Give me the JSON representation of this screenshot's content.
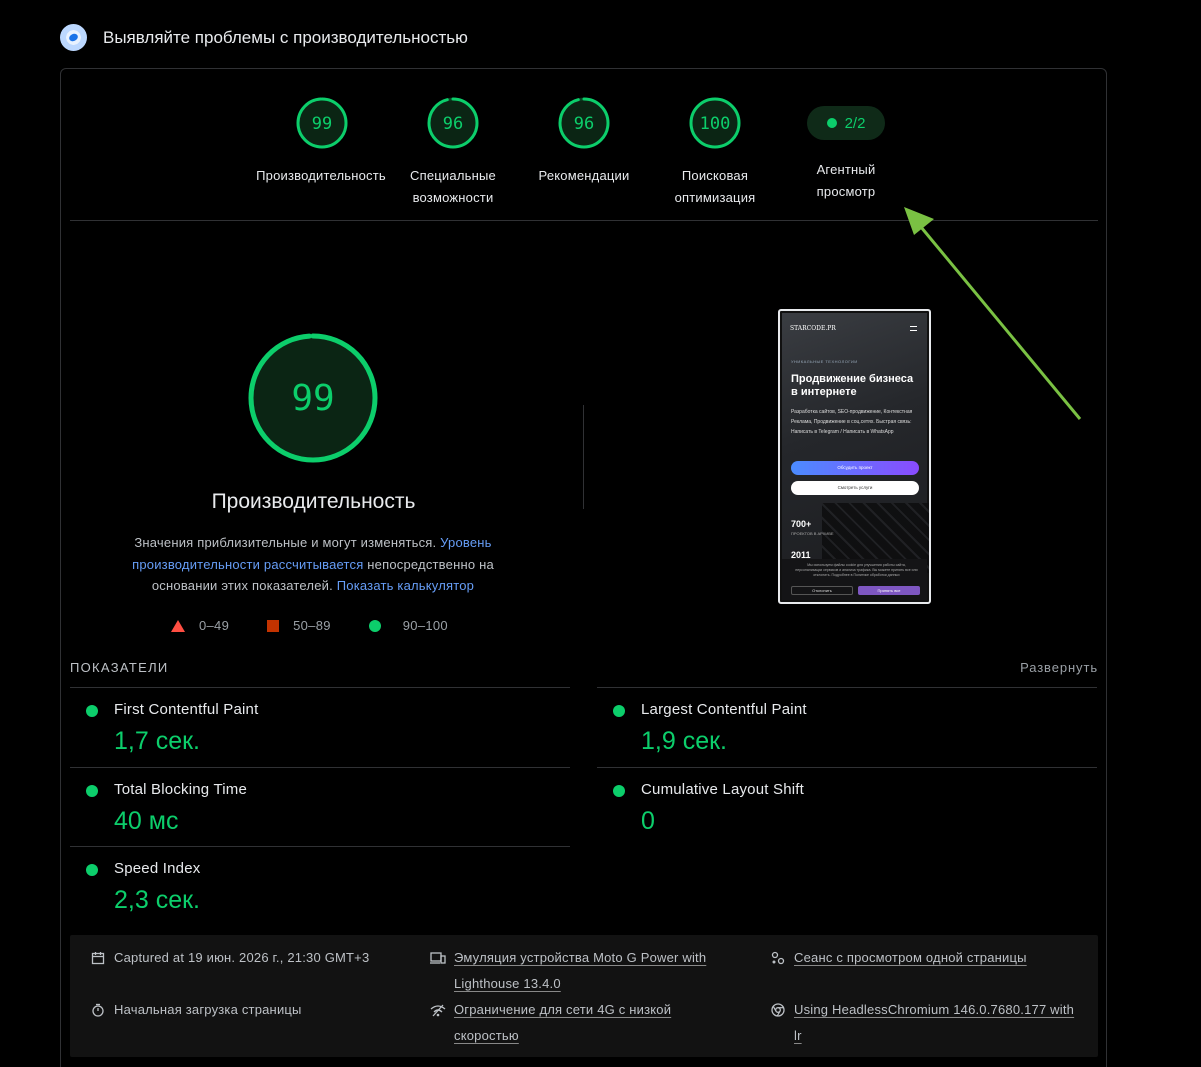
{
  "header": {
    "title": "Выявляйте проблемы с производительностью"
  },
  "categories": [
    {
      "score": "99",
      "label_line1": "Производительность",
      "label_line2": "",
      "value": 99
    },
    {
      "score": "96",
      "label_line1": "Специальные",
      "label_line2": "возможности",
      "value": 96
    },
    {
      "score": "96",
      "label_line1": "Рекомендации",
      "label_line2": "",
      "value": 96
    },
    {
      "score": "100",
      "label_line1": "Поисковая",
      "label_line2": "оптимизация",
      "value": 100
    },
    {
      "score": "2/2",
      "label_line1": "Агентный",
      "label_line2": "просмотр"
    }
  ],
  "performance": {
    "score": "99",
    "value": 99,
    "title": "Производительность",
    "note_text": "Значения приблизительные и могут изменяться. ",
    "note_link1": "Уровень производительности рассчитывается",
    "note_text2": " непосредственно на основании этих показателей. ",
    "note_link2": "Показать калькулятор"
  },
  "legend": {
    "fail": "0–49",
    "average": "50–89",
    "pass": "90–100"
  },
  "colors": {
    "pass": "#0cce6b",
    "average": "#c33300",
    "fail": "#ff4e42",
    "link": "#669df6",
    "arrow": "#7ac143"
  },
  "screenshot": {
    "brand": "STARCODE.PR",
    "eyebrow": "УНИКАЛЬНЫЕ ТЕХНОЛОГИИ",
    "heading": "Продвижение бизнеса в интернете",
    "text": "Разработка сайтов, SEO-продвижение, Контекстная Реклама, Продвижение в соц.сетях. Быстрая связь: Написать в Telegram / Написать в WhatsApp",
    "button1": "Обсудить проект",
    "button2": "Смотреть услуги",
    "stat1": "700+",
    "stat1_label": "ПРОЕКТОВ В АРХИВЕ",
    "stat2": "2011",
    "cookie_text": "Мы используем файлы cookie для улучшения работы сайта, персонализации сервисов и анализа трафика. Вы можете принять все или отклонить. Подробнее в Политике обработки данных",
    "cookie_reject": "Отклонить",
    "cookie_accept": "Принять все"
  },
  "metrics": {
    "heading": "ПОКАЗАТЕЛИ",
    "expand": "Развернуть",
    "items": [
      {
        "name": "First Contentful Paint",
        "value": "1,7 сек."
      },
      {
        "name": "Largest Contentful Paint",
        "value": "1,9 сек."
      },
      {
        "name": "Total Blocking Time",
        "value": "40 мс"
      },
      {
        "name": "Cumulative Layout Shift",
        "value": "0"
      },
      {
        "name": "Speed Index",
        "value": "2,3 сек."
      }
    ]
  },
  "footer": {
    "captured": "Captured at 19 июн. 2026 г., 21:30 GMT+3",
    "initial_load": "Начальная загрузка страницы",
    "emulation_line1": "Эмуляция устройства Moto G Power with",
    "emulation_line2": "Lighthouse 13.4.0",
    "throttle_line1": "Ограничение для сети 4G с низкой",
    "throttle_line2": "скоростью",
    "session": "Сеанс с просмотром одной страницы",
    "browser_line1": "Using HeadlessChromium 146.0.7680.177 with",
    "browser_line2": "lr"
  }
}
